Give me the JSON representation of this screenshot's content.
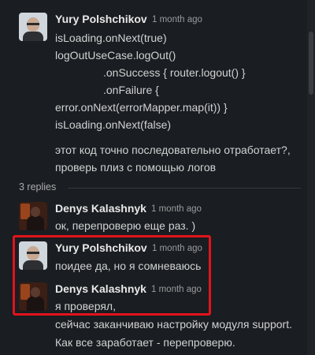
{
  "thread": {
    "messages": [
      {
        "author": "Yury Polshchikov",
        "time": "1 month ago",
        "lines": [
          "isLoading.onNext(true)",
          "logOutUseCase.logOut()",
          ".onSuccess { router.logout() }",
          ".onFailure {",
          "error.onNext(errorMapper.map(it)) }",
          "isLoading.onNext(false)",
          "этот код точно последовательно отработает?,",
          "проверь плиз с помощью логов"
        ]
      }
    ],
    "replies_label": "3 replies",
    "replies": [
      {
        "author": "Denys Kalashnyk",
        "time": "1 month ago",
        "lines": [
          "ок, перепроверю еще раз. )"
        ]
      },
      {
        "author": "Yury Polshchikov",
        "time": "1 month ago",
        "lines": [
          "поидее да, но я сомневаюсь"
        ]
      },
      {
        "author": "Denys Kalashnyk",
        "time": "1 month ago",
        "lines": [
          "я проверял,",
          "сейчас заканчиваю настройку модуля support.",
          "Как все заработает - перепроверю."
        ]
      }
    ]
  },
  "colors": {
    "background": "#1a1d21",
    "text": "#d1d2d3",
    "highlight": "#e0141b"
  }
}
